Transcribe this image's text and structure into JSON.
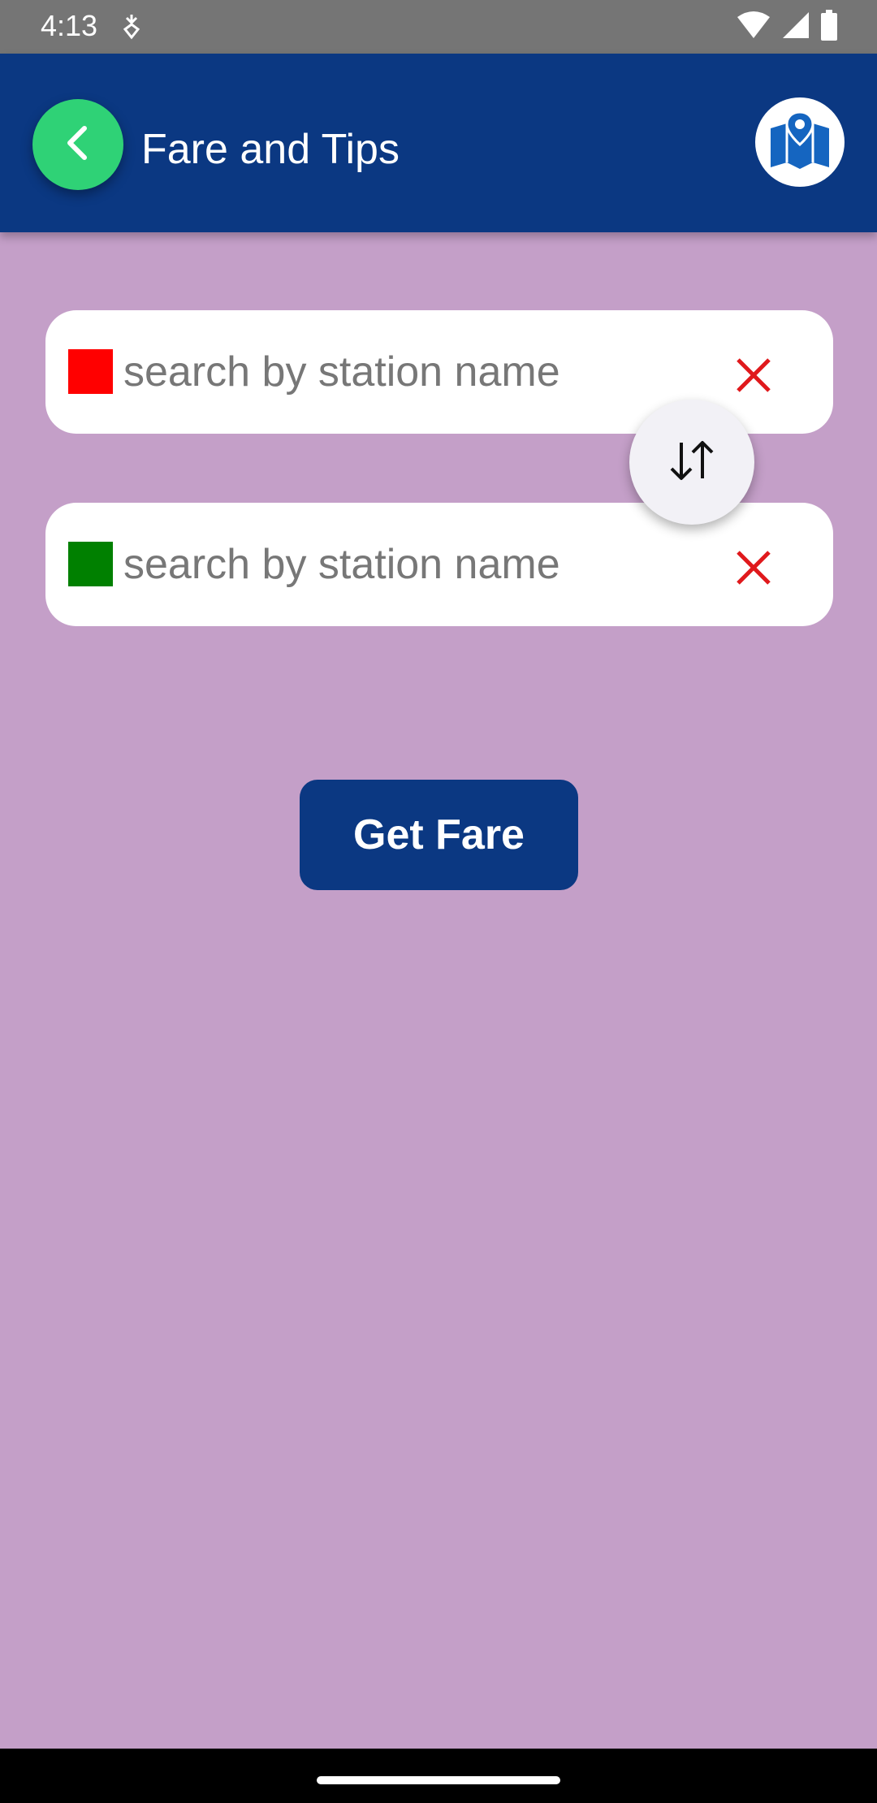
{
  "status_bar": {
    "time": "4:13",
    "icons": [
      "sync-icon",
      "wifi-icon",
      "signal-icon",
      "battery-icon"
    ]
  },
  "app_bar": {
    "title": "Fare and Tips",
    "back_icon": "chevron-left-icon",
    "map_icon": "map-pin-icon",
    "colors": {
      "background": "#0b3882",
      "back_button": "#2fd276"
    }
  },
  "search": {
    "from": {
      "placeholder": "search by station name",
      "value": "",
      "marker_color": "#ff0000"
    },
    "to": {
      "placeholder": "search by station name",
      "value": "",
      "marker_color": "#008000"
    },
    "clear_icon": "close-icon",
    "swap_icon": "swap-vertical-icon"
  },
  "actions": {
    "get_fare_label": "Get Fare"
  },
  "colors": {
    "page_background": "#c49fc8",
    "clear_icon": "#e0191c"
  }
}
